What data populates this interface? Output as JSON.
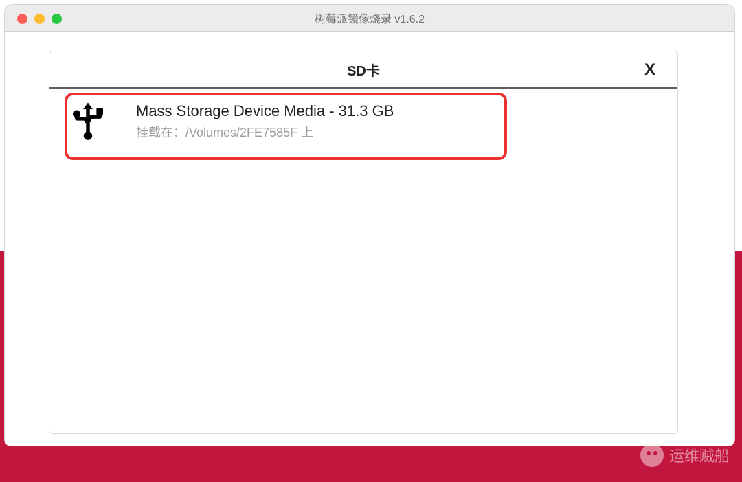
{
  "window": {
    "title": "树莓派镜像烧录 v1.6.2"
  },
  "dialog": {
    "title": "SD卡",
    "close_label": "X"
  },
  "storage": {
    "items": [
      {
        "icon": "usb",
        "primary": "Mass Storage Device Media - 31.3 GB",
        "secondary": "挂载在：/Volumes/2FE7585F 上"
      }
    ]
  },
  "watermark": {
    "text": "运维贼船"
  }
}
